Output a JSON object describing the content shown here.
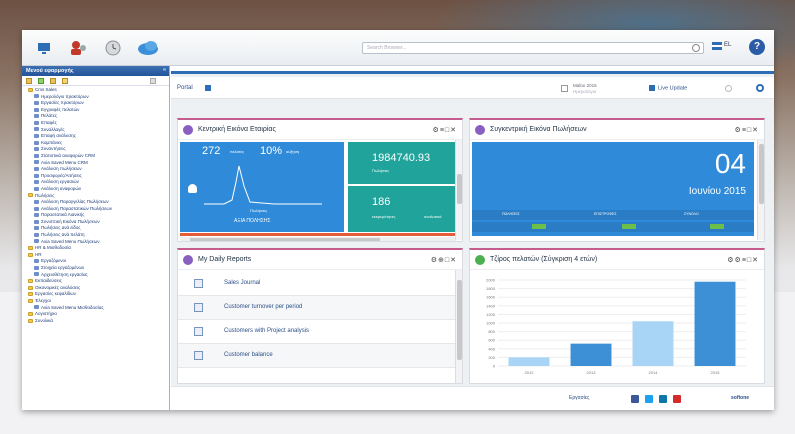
{
  "topbar": {
    "search_placeholder": "Search Browser...",
    "lang": "EL",
    "icons": [
      "monitor-icon",
      "users-icon",
      "clock-icon",
      "cloud-icon",
      "search-icon",
      "flag-icon",
      "help-icon"
    ]
  },
  "sidebar": {
    "title": "Μενού εφαρμογής",
    "items": [
      {
        "label": "Cms Sales",
        "type": "folder"
      },
      {
        "label": "Ημερολόγιο πρακτόρων",
        "type": "leaf"
      },
      {
        "label": "Εργασίες πρακτόρων",
        "type": "leaf"
      },
      {
        "label": "Εγγραφές πελατών",
        "type": "leaf"
      },
      {
        "label": "Πελάτες",
        "type": "leaf"
      },
      {
        "label": "Επαφές",
        "type": "leaf"
      },
      {
        "label": "Συναλλαγές",
        "type": "leaf"
      },
      {
        "label": "Επαφή ανάλυσης",
        "type": "leaf"
      },
      {
        "label": "Καμπάνιες",
        "type": "leaf"
      },
      {
        "label": "Συναντήσεις",
        "type": "leaf"
      },
      {
        "label": "Στατιστικά αναφορών CRM",
        "type": "leaf"
      },
      {
        "label": "Axia Saved Menu CRM",
        "type": "leaf"
      },
      {
        "label": "Ανάλυση πωλήσεων",
        "type": "leaf"
      },
      {
        "label": "Προσφορές/Αιτήσεις",
        "type": "leaf"
      },
      {
        "label": "Ανάλυση εργασιών",
        "type": "leaf"
      },
      {
        "label": "Ανάλυση αναφορών",
        "type": "leaf"
      },
      {
        "label": "Πωλήσεις",
        "type": "folder"
      },
      {
        "label": "Ανάλυση Παραγγελίας Πωλήσεων",
        "type": "leaf"
      },
      {
        "label": "Ανάλυση Παραστατικών Πωλήσεων",
        "type": "leaf"
      },
      {
        "label": "Παραστατικά Λιανικής",
        "type": "leaf"
      },
      {
        "label": "Συνοπτική Εικόνα Πωλήσεων",
        "type": "leaf"
      },
      {
        "label": "Πωλήσεις ανά είδος",
        "type": "leaf"
      },
      {
        "label": "Πωλήσεις ανά πελάτη",
        "type": "leaf"
      },
      {
        "label": "Axia Saved Menu Πωλήσεων",
        "type": "leaf"
      },
      {
        "label": "HR & Μισθοδοσία",
        "type": "folder"
      },
      {
        "label": "HR",
        "type": "folder"
      },
      {
        "label": "Εργαζόμενοι",
        "type": "leaf"
      },
      {
        "label": "Στοιχεία εργαζομένων",
        "type": "leaf"
      },
      {
        "label": "Αρχειοθέτηση εργασίας",
        "type": "leaf"
      },
      {
        "label": "Εκπαιδεύσεις",
        "type": "folder"
      },
      {
        "label": "Οικονομικές αναλύσεις",
        "type": "folder"
      },
      {
        "label": "Εργασίες κεφαλίδων",
        "type": "folder"
      },
      {
        "label": "Έλεγχοι",
        "type": "folder"
      },
      {
        "label": "Axia Saved Menu Μισθοδοσίας",
        "type": "leaf"
      },
      {
        "label": "Λογιστήριο",
        "type": "folder"
      },
      {
        "label": "Συνολικά",
        "type": "folder"
      }
    ]
  },
  "main": {
    "tab_label": "Portal",
    "calendar_line1": "Μαΐου 2015",
    "calendar_line2": "Ημερολόγιο",
    "live_update": "Live Update"
  },
  "panel1": {
    "title": "Κεντρική Εικόνα Εταιρίας",
    "kpi_value": "272",
    "kpi_small": "πελάτες",
    "kpi_percent": "10%",
    "kpi_percent_small": "αύξηση",
    "chart_caption": "Πωλήσεις",
    "tile_label": "ΑΞΙΑ ΠΟΛΗΣΗΣ",
    "tile2_value": "1984740.93",
    "tile2_label": "Πωλήσεις",
    "tile3_value": "186",
    "tile3_label": "εκκρεμότητες",
    "tile3_small": "αναλυτικά"
  },
  "panel2": {
    "title": "Συγκεντρική Εικόνα Πωλήσεων",
    "day": "04",
    "month_year": "Ιουνίου 2015",
    "cols": [
      "ΠΩΛΗΣΕΙΣ",
      "ΕΠΙΣΤΡΟΦΕΣ",
      "ΣΥΝΟΛΟ"
    ]
  },
  "panel3": {
    "title": "My Daily Reports",
    "reports": [
      "Sales Journal",
      "Customer turnover per period",
      "Customers with Project analysis",
      "Customer balance"
    ]
  },
  "panel4": {
    "title": "Τζίρος πελατών (Σύγκριση 4 ετών)",
    "chart_data": {
      "type": "bar",
      "categories": [
        "2012",
        "2013",
        "2014",
        "2015"
      ],
      "values": [
        200,
        520,
        1040,
        1960
      ],
      "ylim": [
        0,
        2000
      ],
      "yticks": [
        "2000",
        "1800",
        "1600",
        "1400",
        "1200",
        "1000",
        "800",
        "600",
        "400",
        "200",
        "0"
      ],
      "colors": [
        "#a8d4f5",
        "#3d8fd6",
        "#a8d4f5",
        "#3d8fd6"
      ]
    }
  },
  "footer": {
    "link": "Εργασίες",
    "brand": "softone"
  }
}
